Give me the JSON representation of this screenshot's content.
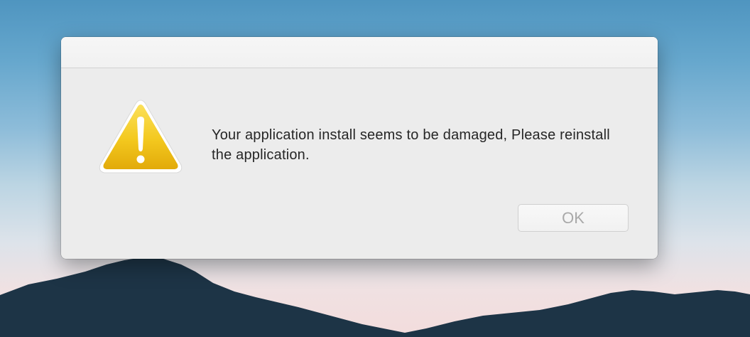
{
  "dialog": {
    "message": "Your application install seems to be damaged, Please reinstall the application.",
    "ok_button_label": "OK",
    "icon": "warning-triangle-icon"
  },
  "colors": {
    "warning_yellow": "#f2c518",
    "button_text_disabled": "#a9a9a9",
    "dialog_background": "#ececec"
  }
}
